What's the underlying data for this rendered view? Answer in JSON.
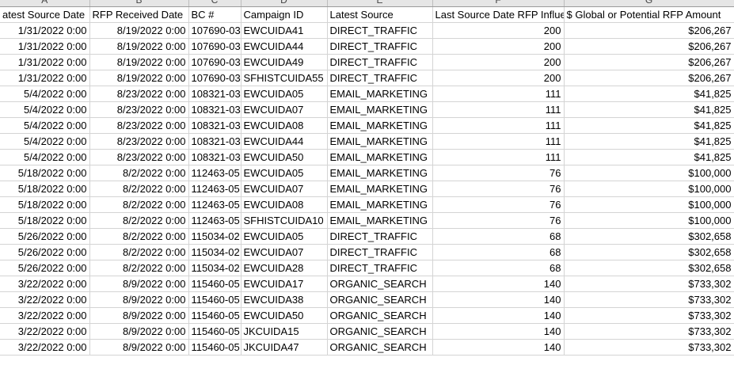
{
  "columns": [
    {
      "letter": "A",
      "header": "atest Source Date"
    },
    {
      "letter": "B",
      "header": "RFP Received Date"
    },
    {
      "letter": "C",
      "header": "BC #"
    },
    {
      "letter": "D",
      "header": "Campaign ID"
    },
    {
      "letter": "E",
      "header": "Latest Source"
    },
    {
      "letter": "F",
      "header": "Last Source Date RFP Influe"
    },
    {
      "letter": "G",
      "header": "$ Global or Potential RFP Amount"
    }
  ],
  "rows": [
    [
      "1/31/2022 0:00",
      "8/19/2022 0:00",
      "107690-03",
      "EWCUIDA41",
      "DIRECT_TRAFFIC",
      "200",
      "$206,267"
    ],
    [
      "1/31/2022 0:00",
      "8/19/2022 0:00",
      "107690-03",
      "EWCUIDA44",
      "DIRECT_TRAFFIC",
      "200",
      "$206,267"
    ],
    [
      "1/31/2022 0:00",
      "8/19/2022 0:00",
      "107690-03",
      "EWCUIDA49",
      "DIRECT_TRAFFIC",
      "200",
      "$206,267"
    ],
    [
      "1/31/2022 0:00",
      "8/19/2022 0:00",
      "107690-03",
      "SFHISTCUIDA55",
      "DIRECT_TRAFFIC",
      "200",
      "$206,267"
    ],
    [
      "5/4/2022 0:00",
      "8/23/2022 0:00",
      "108321-03",
      "EWCUIDA05",
      "EMAIL_MARKETING",
      "111",
      "$41,825"
    ],
    [
      "5/4/2022 0:00",
      "8/23/2022 0:00",
      "108321-03",
      "EWCUIDA07",
      "EMAIL_MARKETING",
      "111",
      "$41,825"
    ],
    [
      "5/4/2022 0:00",
      "8/23/2022 0:00",
      "108321-03",
      "EWCUIDA08",
      "EMAIL_MARKETING",
      "111",
      "$41,825"
    ],
    [
      "5/4/2022 0:00",
      "8/23/2022 0:00",
      "108321-03",
      "EWCUIDA44",
      "EMAIL_MARKETING",
      "111",
      "$41,825"
    ],
    [
      "5/4/2022 0:00",
      "8/23/2022 0:00",
      "108321-03",
      "EWCUIDA50",
      "EMAIL_MARKETING",
      "111",
      "$41,825"
    ],
    [
      "5/18/2022 0:00",
      "8/2/2022 0:00",
      "112463-05",
      "EWCUIDA05",
      "EMAIL_MARKETING",
      "76",
      "$100,000"
    ],
    [
      "5/18/2022 0:00",
      "8/2/2022 0:00",
      "112463-05",
      "EWCUIDA07",
      "EMAIL_MARKETING",
      "76",
      "$100,000"
    ],
    [
      "5/18/2022 0:00",
      "8/2/2022 0:00",
      "112463-05",
      "EWCUIDA08",
      "EMAIL_MARKETING",
      "76",
      "$100,000"
    ],
    [
      "5/18/2022 0:00",
      "8/2/2022 0:00",
      "112463-05",
      "SFHISTCUIDA10",
      "EMAIL_MARKETING",
      "76",
      "$100,000"
    ],
    [
      "5/26/2022 0:00",
      "8/2/2022 0:00",
      "115034-02",
      "EWCUIDA05",
      "DIRECT_TRAFFIC",
      "68",
      "$302,658"
    ],
    [
      "5/26/2022 0:00",
      "8/2/2022 0:00",
      "115034-02",
      "EWCUIDA07",
      "DIRECT_TRAFFIC",
      "68",
      "$302,658"
    ],
    [
      "5/26/2022 0:00",
      "8/2/2022 0:00",
      "115034-02",
      "EWCUIDA28",
      "DIRECT_TRAFFIC",
      "68",
      "$302,658"
    ],
    [
      "3/22/2022 0:00",
      "8/9/2022 0:00",
      "115460-05",
      "EWCUIDA17",
      "ORGANIC_SEARCH",
      "140",
      "$733,302"
    ],
    [
      "3/22/2022 0:00",
      "8/9/2022 0:00",
      "115460-05",
      "EWCUIDA38",
      "ORGANIC_SEARCH",
      "140",
      "$733,302"
    ],
    [
      "3/22/2022 0:00",
      "8/9/2022 0:00",
      "115460-05",
      "EWCUIDA50",
      "ORGANIC_SEARCH",
      "140",
      "$733,302"
    ],
    [
      "3/22/2022 0:00",
      "8/9/2022 0:00",
      "115460-05",
      "JKCUIDA15",
      "ORGANIC_SEARCH",
      "140",
      "$733,302"
    ],
    [
      "3/22/2022 0:00",
      "8/9/2022 0:00",
      "115460-05",
      "JKCUIDA47",
      "ORGANIC_SEARCH",
      "140",
      "$733,302"
    ]
  ],
  "align": [
    "r",
    "r",
    "l",
    "l",
    "l",
    "r",
    "r"
  ]
}
